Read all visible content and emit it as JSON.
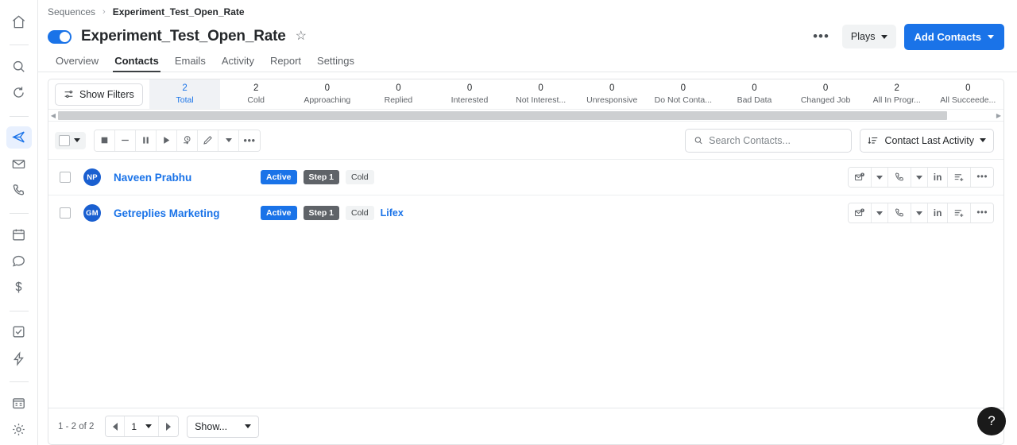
{
  "rail": {
    "top_items": [
      {
        "name": "home-icon",
        "label": "Home"
      }
    ],
    "group2": [
      {
        "name": "search-icon",
        "label": "Search"
      },
      {
        "name": "sync-icon",
        "label": "Sync"
      }
    ],
    "group3": [
      {
        "name": "send-icon",
        "label": "Sequences",
        "active": true
      },
      {
        "name": "envelope-icon",
        "label": "Emails"
      },
      {
        "name": "phone-icon",
        "label": "Calls"
      }
    ],
    "group4": [
      {
        "name": "calendar-icon",
        "label": "Calendar"
      },
      {
        "name": "chat-icon",
        "label": "Conversations"
      },
      {
        "name": "dollar-icon",
        "label": "Deals"
      }
    ],
    "group5": [
      {
        "name": "task-icon",
        "label": "Tasks"
      },
      {
        "name": "bolt-icon",
        "label": "Automation"
      }
    ],
    "group6": [
      {
        "name": "report-icon",
        "label": "Reports"
      },
      {
        "name": "gear-icon",
        "label": "Settings"
      }
    ]
  },
  "breadcrumb": {
    "parent": "Sequences",
    "separator": "›",
    "current": "Experiment_Test_Open_Rate"
  },
  "header": {
    "title": "Experiment_Test_Open_Rate",
    "toggle_on": true,
    "star": "☆",
    "more_label": "•••",
    "plays_label": "Plays",
    "add_contacts_label": "Add Contacts",
    "accent_color": "#1a73e8"
  },
  "nav_tabs": [
    {
      "label": "Overview",
      "active": false
    },
    {
      "label": "Contacts",
      "active": true
    },
    {
      "label": "Emails",
      "active": false
    },
    {
      "label": "Activity",
      "active": false
    },
    {
      "label": "Report",
      "active": false
    },
    {
      "label": "Settings",
      "active": false
    }
  ],
  "filters": {
    "button_label": "Show Filters"
  },
  "stats": [
    {
      "value": "2",
      "label": "Total",
      "active": true
    },
    {
      "value": "2",
      "label": "Cold",
      "active": false
    },
    {
      "value": "0",
      "label": "Approaching",
      "active": false
    },
    {
      "value": "0",
      "label": "Replied",
      "active": false
    },
    {
      "value": "0",
      "label": "Interested",
      "active": false
    },
    {
      "value": "0",
      "label": "Not Interest...",
      "active": false
    },
    {
      "value": "0",
      "label": "Unresponsive",
      "active": false
    },
    {
      "value": "0",
      "label": "Do Not Conta...",
      "active": false
    },
    {
      "value": "0",
      "label": "Bad Data",
      "active": false
    },
    {
      "value": "0",
      "label": "Changed Job",
      "active": false
    },
    {
      "value": "2",
      "label": "All In Progr...",
      "active": false
    },
    {
      "value": "0",
      "label": "All Succeede...",
      "active": false
    }
  ],
  "toolbar": {
    "actions": [
      {
        "name": "stop-button",
        "label": "Stop"
      },
      {
        "name": "minus-button",
        "label": "Remove"
      },
      {
        "name": "pause-button",
        "label": "Pause"
      },
      {
        "name": "play-button",
        "label": "Resume"
      },
      {
        "name": "reschedule-button",
        "label": "Reschedule"
      },
      {
        "name": "edit-button",
        "label": "Edit"
      },
      {
        "name": "edit-dropdown-button",
        "label": "More edit options"
      },
      {
        "name": "more-actions-button",
        "label": "•••"
      }
    ]
  },
  "search": {
    "placeholder": "Search Contacts...",
    "value": ""
  },
  "sort": {
    "label": "Contact Last Activity"
  },
  "table": {
    "rows": [
      {
        "initials": "NP",
        "name": "Naveen Prabhu",
        "status_badge": "Active",
        "step_badge": "Step 1",
        "stage_badge": "Cold",
        "company": "",
        "checked": false
      },
      {
        "initials": "GM",
        "name": "Getreplies Marketing",
        "status_badge": "Active",
        "step_badge": "Step 1",
        "stage_badge": "Cold",
        "company": "Lifex",
        "checked": false
      }
    ],
    "row_actions": [
      {
        "name": "email-button",
        "label": "Email"
      },
      {
        "name": "email-dropdown-button",
        "label": "Email options"
      },
      {
        "name": "call-button",
        "label": "Call"
      },
      {
        "name": "call-dropdown-button",
        "label": "Call options"
      },
      {
        "name": "linkedin-button",
        "label": "in"
      },
      {
        "name": "add-task-button",
        "label": "Add task"
      },
      {
        "name": "row-more-button",
        "label": "•••"
      }
    ]
  },
  "footer": {
    "range": "1 - 2 of 2",
    "page": "1",
    "show_label": "Show..."
  },
  "help": {
    "label": "?"
  }
}
